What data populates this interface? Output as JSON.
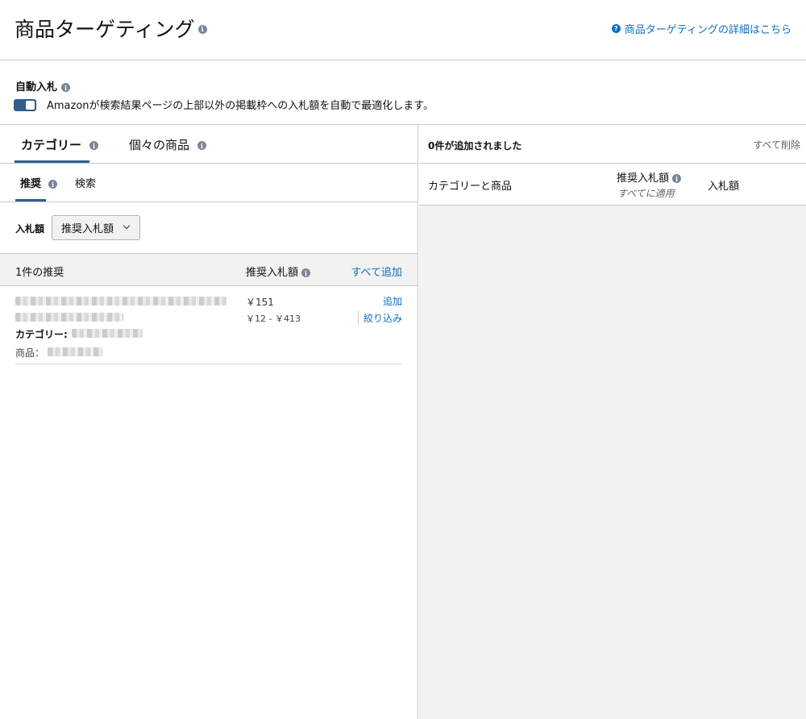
{
  "header": {
    "title": "商品ターゲティング",
    "help_link": "商品ターゲティングの詳細はこちら"
  },
  "auto_bid": {
    "title": "自動入札",
    "enabled": true,
    "description": "Amazonが検索結果ページの上部以外の掲載枠への入札額を自動で最適化します。"
  },
  "main_tabs": [
    {
      "label": "カテゴリー",
      "active": true
    },
    {
      "label": "個々の商品",
      "active": false
    }
  ],
  "sub_tabs": [
    {
      "label": "推奨",
      "active": true
    },
    {
      "label": "検索",
      "active": false
    }
  ],
  "bid_control": {
    "label": "入札額",
    "selected": "推奨入札額"
  },
  "recommendations": {
    "count_label": "1件の推奨",
    "bid_header": "推奨入札額",
    "add_all": "すべて追加",
    "items": [
      {
        "category_label": "カテゴリー:",
        "product_label": "商品：",
        "bid": "￥151",
        "range": "￥12 - ￥413",
        "add": "追加",
        "refine": "絞り込み"
      }
    ]
  },
  "added": {
    "count_label": "0件が追加されました",
    "remove_all": "すべて削除",
    "columns": {
      "category_product": "カテゴリーと商品",
      "suggested_bid": "推奨入札額",
      "apply_all": "すべてに適用",
      "bid": "入札額"
    }
  },
  "colors": {
    "accent": "#2f5f8f",
    "link": "#0f6fbf",
    "border": "#c9c9c9",
    "panel_bg": "#f2f2f2"
  }
}
